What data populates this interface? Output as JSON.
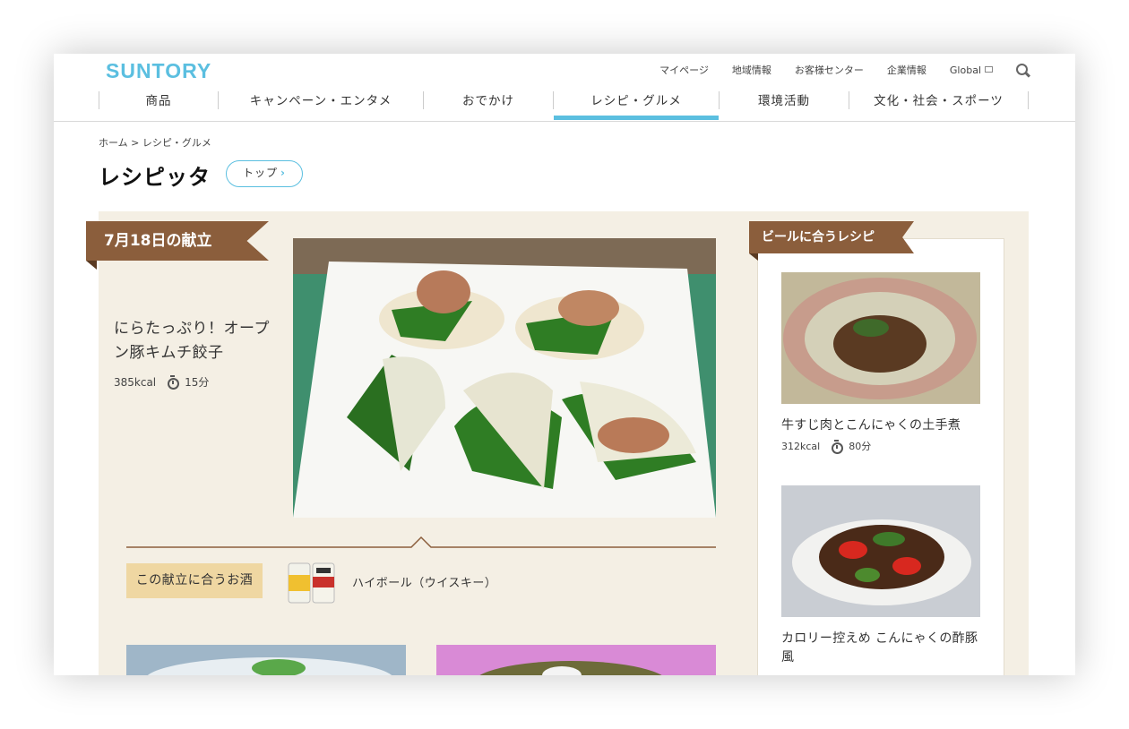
{
  "brand": {
    "logo_text": "SUNTORY",
    "accent_color": "#5bbfe0",
    "ribbon_color": "#8b5e3c"
  },
  "utility_nav": [
    "マイページ",
    "地域情報",
    "お客様センター",
    "企業情報",
    "Global"
  ],
  "global_nav": [
    "商品",
    "キャンペーン・エンタメ",
    "おでかけ",
    "レシピ・グルメ",
    "環境活動",
    "文化・社会・スポーツ"
  ],
  "active_nav": "レシピ・グルメ",
  "breadcrumb": "ホーム > レシピ・グルメ",
  "page": {
    "title": "レシピッタ",
    "top_button": "トップ"
  },
  "featured": {
    "ribbon": "7月18日の献立",
    "title": "にらたっぷり！オープン豚キムチ餃子",
    "kcal": "385kcal",
    "time": "15分",
    "pairing_label": "この献立に合うお酒",
    "pairing_name": "ハイボール（ウイスキー）"
  },
  "sidebar": {
    "ribbon": "ビールに合うレシピ",
    "items": [
      {
        "title": "牛すじ肉とこんにゃくの土手煮",
        "kcal": "312kcal",
        "time": "80分"
      },
      {
        "title": "カロリー控えめ こんにゃくの酢豚風"
      }
    ]
  }
}
